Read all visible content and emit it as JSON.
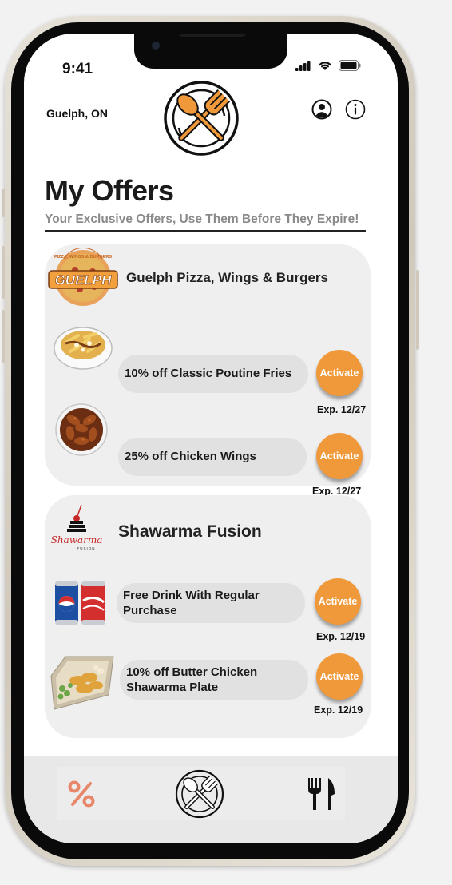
{
  "status_bar": {
    "time": "9:41"
  },
  "header": {
    "location": "Guelph, ON",
    "logo_icon": "plate-spoon-fork-icon",
    "profile_icon": "person-circle-icon",
    "info_icon": "info-circle-icon"
  },
  "page": {
    "title": "My Offers",
    "subtitle": "Your Exclusive Offers, Use Them Before They Expire!"
  },
  "restaurants": [
    {
      "name": "Guelph Pizza, Wings & Burgers",
      "logo_text": "GUELPH",
      "logo_arc_text": "PIZZA, WINGS & BURGERS",
      "offers": [
        {
          "label": "10% off Classic Poutine Fries",
          "action": "Activate",
          "expiry": "Exp. 12/27",
          "image": "poutine-fries"
        },
        {
          "label": "25% off Chicken Wings",
          "action": "Activate",
          "expiry": "Exp. 12/27",
          "image": "chicken-wings"
        }
      ]
    },
    {
      "name": "Shawarma Fusion",
      "logo_text": "Shawarma",
      "logo_sub": "FUSION",
      "offers": [
        {
          "label": "Free Drink With Regular Purchase",
          "action": "Activate",
          "expiry": "Exp. 12/19",
          "image": "soda-cans"
        },
        {
          "label": "10% off Butter Chicken Shawarma Plate",
          "action": "Activate",
          "expiry": "Exp. 12/19",
          "image": "shawarma-plate"
        }
      ]
    }
  ],
  "tab_bar": {
    "items": [
      {
        "icon": "percent-icon",
        "selected": true
      },
      {
        "icon": "plate-spoon-fork-icon",
        "selected": false
      },
      {
        "icon": "fork-knife-icon",
        "selected": false
      }
    ]
  },
  "colors": {
    "accent": "#f0993a",
    "card_background": "#efefef",
    "pill_background": "#e1e1e1",
    "subtitle": "#8a8a8a",
    "percent_icon": "#e8866a"
  }
}
